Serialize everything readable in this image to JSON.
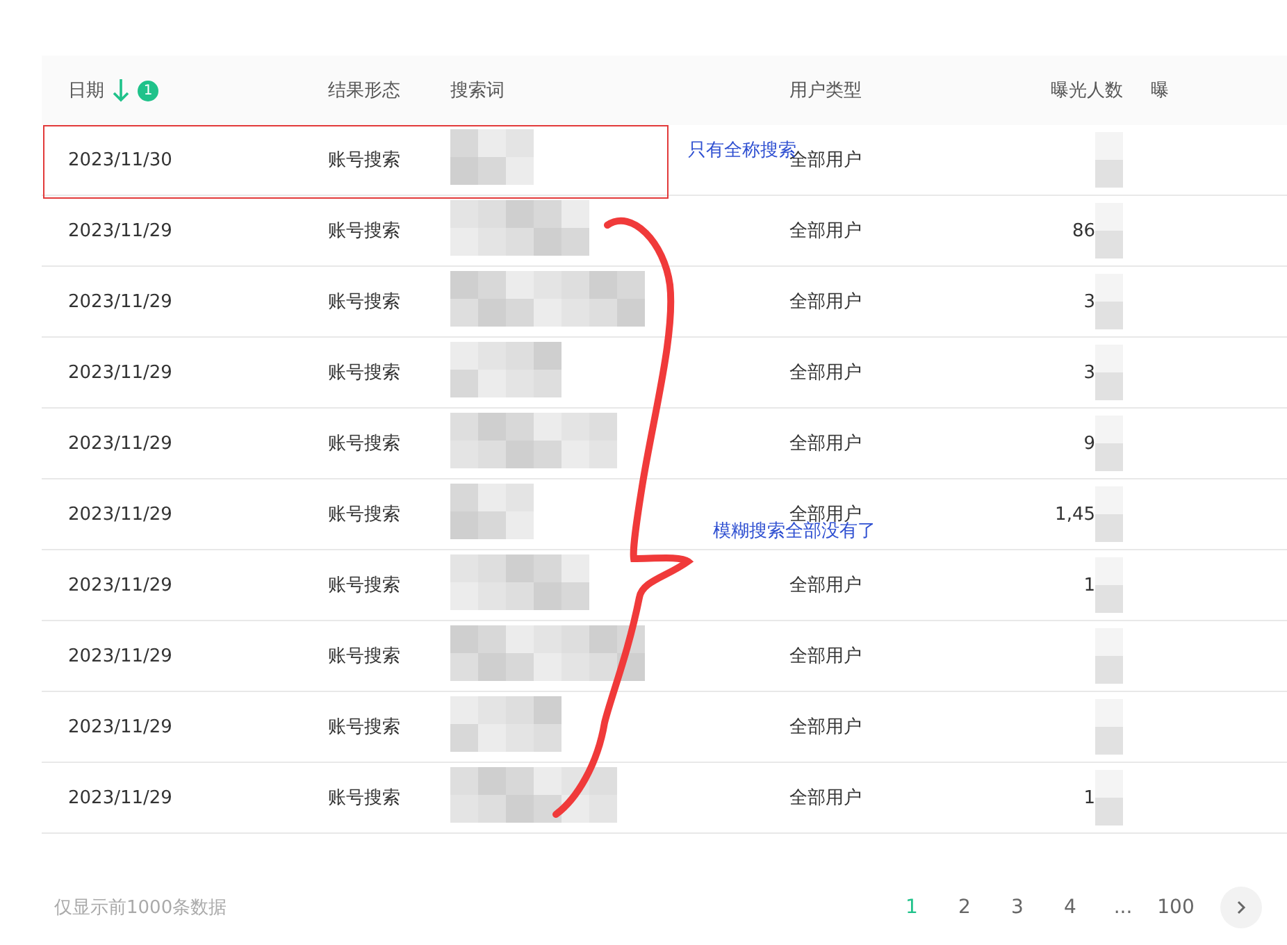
{
  "table": {
    "columns": [
      {
        "label": "日期",
        "sorted_descending": true,
        "badge": "1"
      },
      {
        "label": "结果形态"
      },
      {
        "label": "搜索词"
      },
      {
        "label": "用户类型"
      },
      {
        "label": "曝光人数"
      },
      {
        "label": "曝"
      }
    ],
    "rows": [
      {
        "date": "2023/11/30",
        "form": "账号搜索",
        "user_type": "全部用户"
      },
      {
        "date": "2023/11/29",
        "form": "账号搜索",
        "user_type": "全部用户",
        "exposure": "86"
      },
      {
        "date": "2023/11/29",
        "form": "账号搜索",
        "user_type": "全部用户",
        "exposure": "3"
      },
      {
        "date": "2023/11/29",
        "form": "账号搜索",
        "user_type": "全部用户",
        "exposure": "3"
      },
      {
        "date": "2023/11/29",
        "form": "账号搜索",
        "user_type": "全部用户",
        "exposure": "9"
      },
      {
        "date": "2023/11/29",
        "form": "账号搜索",
        "user_type": "全部用户",
        "exposure": "1,45"
      },
      {
        "date": "2023/11/29",
        "form": "账号搜索",
        "user_type": "全部用户",
        "exposure": "1"
      },
      {
        "date": "2023/11/29",
        "form": "账号搜索",
        "user_type": "全部用户"
      },
      {
        "date": "2023/11/29",
        "form": "账号搜索",
        "user_type": "全部用户"
      },
      {
        "date": "2023/11/29",
        "form": "账号搜索",
        "user_type": "全部用户",
        "exposure": "1"
      }
    ]
  },
  "footer_note": "仅显示前1000条数据",
  "pagination": {
    "pages": [
      {
        "label": "1",
        "selected": true
      },
      {
        "label": "2",
        "selected": false
      },
      {
        "label": "3",
        "selected": false
      },
      {
        "label": "4",
        "selected": false
      },
      {
        "label": "...",
        "selected": false
      },
      {
        "label": "100",
        "selected": false
      }
    ]
  },
  "annotations": [
    {
      "text": "只有全称搜索"
    },
    {
      "text": "模糊搜索全部没有了"
    }
  ]
}
